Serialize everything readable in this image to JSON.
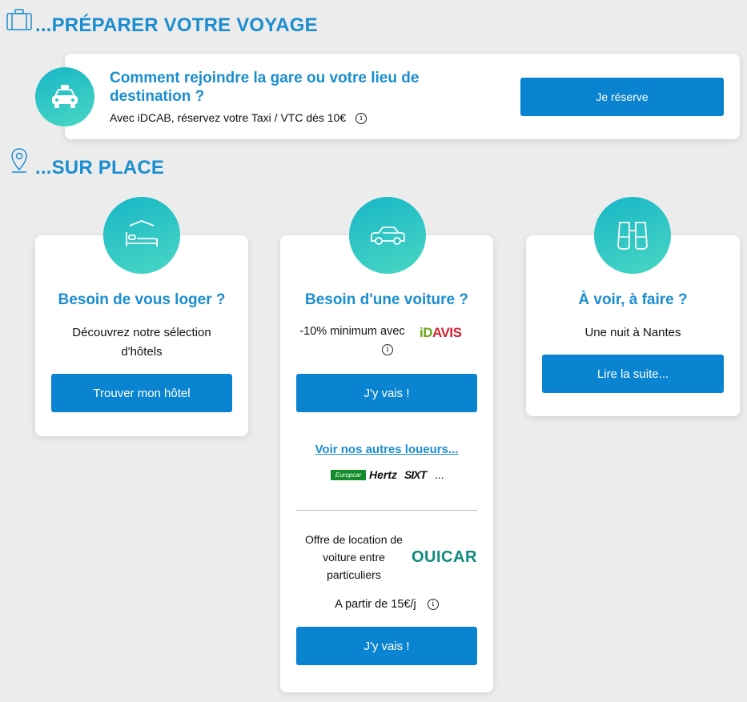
{
  "sections": {
    "prepare_title": "...PRÉPARER VOTRE VOYAGE",
    "onsite_title": "...SUR PLACE"
  },
  "taxi": {
    "title": "Comment rejoindre la gare ou votre lieu de destination ?",
    "subtitle": "Avec iDCAB, réservez votre Taxi / VTC dès 10€",
    "button": "Je réserve"
  },
  "hotel": {
    "title": "Besoin de vous loger ?",
    "text": "Découvrez notre sélection d'hôtels",
    "button": "Trouver mon hôtel"
  },
  "car": {
    "title": "Besoin d'une voiture ?",
    "offer_text": "-10% minimum avec",
    "brand_avis": "iDAVIS",
    "button": "J'y vais !",
    "other_link": "Voir nos autres loueurs...",
    "logos": [
      "Europcar",
      "Hertz",
      "SIXT",
      "..."
    ],
    "ouicar_text": "Offre de location de voiture entre particuliers",
    "brand_ouicar": "OUICAR",
    "price_text": "A partir de 15€/j",
    "button2": "J'y vais !"
  },
  "todo": {
    "title": "À voir, à faire ?",
    "text": "Une nuit à Nantes",
    "button": "Lire la suite..."
  },
  "icons": {
    "luggage": "luggage-icon",
    "location_pin": "location-pin-icon",
    "taxi": "taxi-icon",
    "bed": "bed-icon",
    "car": "car-icon",
    "binoculars": "binoculars-icon",
    "info": "i"
  },
  "colors": {
    "accent": "#1b8ed0",
    "button": "#0a84d0",
    "circle_start": "#18b6c6",
    "circle_end": "#49d7c3",
    "avis_green": "#6aa51a",
    "avis_red": "#d4202b",
    "ouicar": "#0e8a7e",
    "europcar": "#128c2a"
  }
}
